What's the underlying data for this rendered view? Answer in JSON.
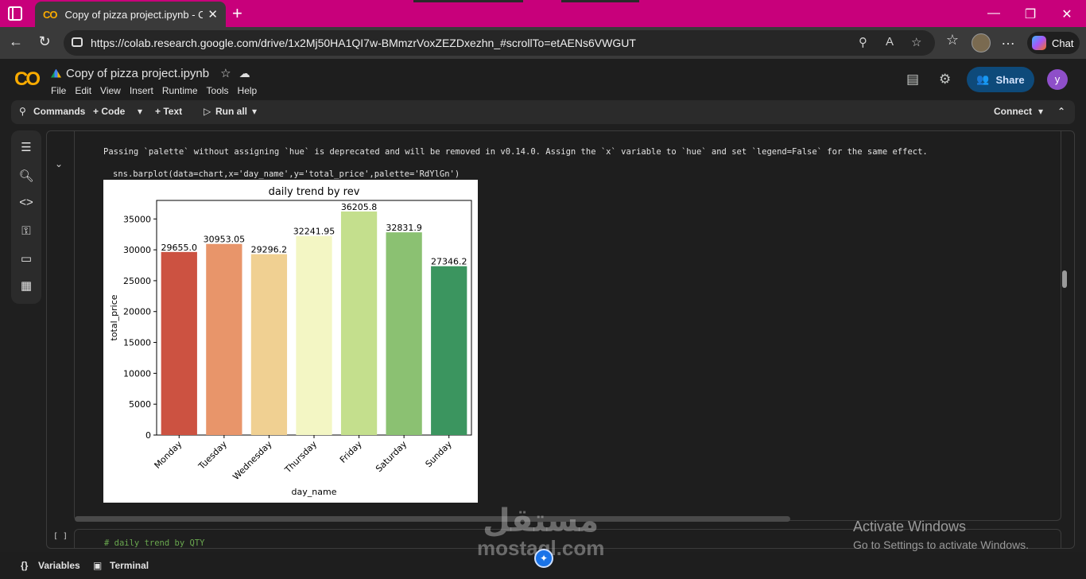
{
  "browser": {
    "tab_title": "Copy of pizza project.ipynb - Cola",
    "url": "https://colab.research.google.com/drive/1x2Mj50HA1QI7w-BMmzrVoxZEZDxezhn_#scrollTo=etAENs6VWGUT",
    "chat_label": "Chat"
  },
  "colab": {
    "logo": "CO",
    "notebook_title": "Copy of pizza project.ipynb",
    "menu": [
      "File",
      "Edit",
      "View",
      "Insert",
      "Runtime",
      "Tools",
      "Help"
    ],
    "share_label": "Share",
    "user_initial": "y"
  },
  "toolbar": {
    "commands": "Commands",
    "code": "+ Code",
    "text": "+ Text",
    "run_all": "Run all",
    "connect": "Connect"
  },
  "cell": {
    "warning": "Passing `palette` without assigning `hue` is deprecated and will be removed in v0.14.0. Assign the `x` variable to `hue` and set `legend=False` for the same effect.",
    "code": "sns.barplot(data=chart,x='day_name',y='total_price',palette='RdYlGn')",
    "next_bracket": "[ ]",
    "next_code": "# daily trend by QTY"
  },
  "chart_data": {
    "type": "bar",
    "title": "daily trend by rev",
    "xlabel": "day_name",
    "ylabel": "total_price",
    "categories": [
      "Monday",
      "Tuesday",
      "Wednesday",
      "Thursday",
      "Friday",
      "Saturday",
      "Sunday"
    ],
    "values": [
      29655.0,
      30953.05,
      29296.2,
      32241.95,
      36205.8,
      32831.9,
      27346.2
    ],
    "value_labels": [
      "29655.0",
      "30953.05",
      "29296.2",
      "32241.95",
      "36205.8",
      "32831.9",
      "27346.2"
    ],
    "colors": [
      "#cc5241",
      "#e8956a",
      "#f0d092",
      "#f3f6c4",
      "#c4df8d",
      "#8bc172",
      "#3b955f"
    ],
    "yticks": [
      0,
      5000,
      10000,
      15000,
      20000,
      25000,
      30000,
      35000
    ],
    "ylim": [
      0,
      38000
    ],
    "grid": false
  },
  "statusbar": {
    "variables": "Variables",
    "terminal": "Terminal"
  },
  "watermark": {
    "activate_title": "Activate Windows",
    "activate_sub": "Go to Settings to activate Windows.",
    "mostaql_ar": "مستقل",
    "mostaql_en": "mostaql.com"
  }
}
